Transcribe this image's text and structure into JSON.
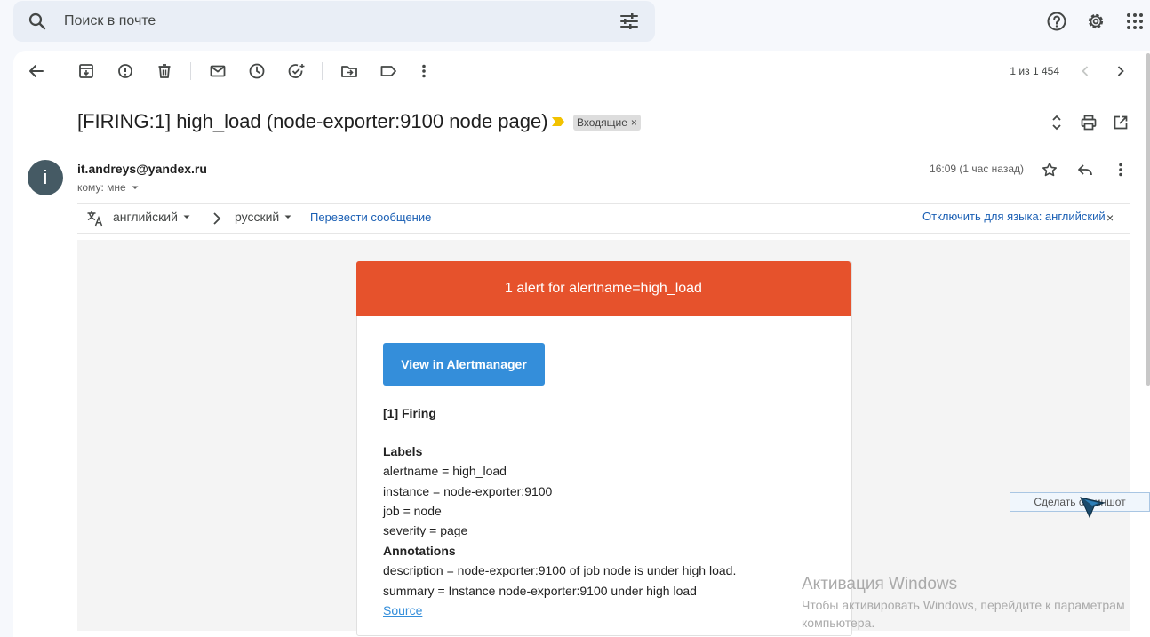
{
  "search": {
    "placeholder": "Поиск в почте"
  },
  "toolbar": {
    "counter": "1 из 1 454"
  },
  "message": {
    "subject": "[FIRING:1] high_load (node-exporter:9100 node page)",
    "label": "Входящие",
    "label_close": "×",
    "avatar_letter": "i",
    "sender": "it.andreys@yandex.ru",
    "to": "кому: мне",
    "time": "16:09 (1 час назад)"
  },
  "translate": {
    "from_lang": "английский",
    "to_lang": "русский",
    "translate_link": "Перевести сообщение",
    "disable_link": "Отключить для языка: английский",
    "close": "×"
  },
  "email": {
    "header": "1 alert for alertname=high_load",
    "button": "View in Alertmanager",
    "firing": "[1] Firing",
    "labels_title": "Labels",
    "labels": [
      "alertname = high_load",
      "instance = node-exporter:9100",
      "job = node",
      "severity = page"
    ],
    "annotations_title": "Annotations",
    "annotations": [
      "description = node-exporter:9100 of job node is under high load.",
      "summary = Instance node-exporter:9100 under high load"
    ],
    "source_link": "Source"
  },
  "overlays": {
    "screenshot_tooltip": "Сделать скриншот",
    "activation_title": "Активация Windows",
    "activation_desc_1": "Чтобы активировать Windows, перейдите к параметрам",
    "activation_desc_2": "компьютера."
  },
  "colors": {
    "alert_header": "#e6522c",
    "alert_button": "#348eda",
    "avatar": "#455a64",
    "link": "#1a5fb4"
  }
}
